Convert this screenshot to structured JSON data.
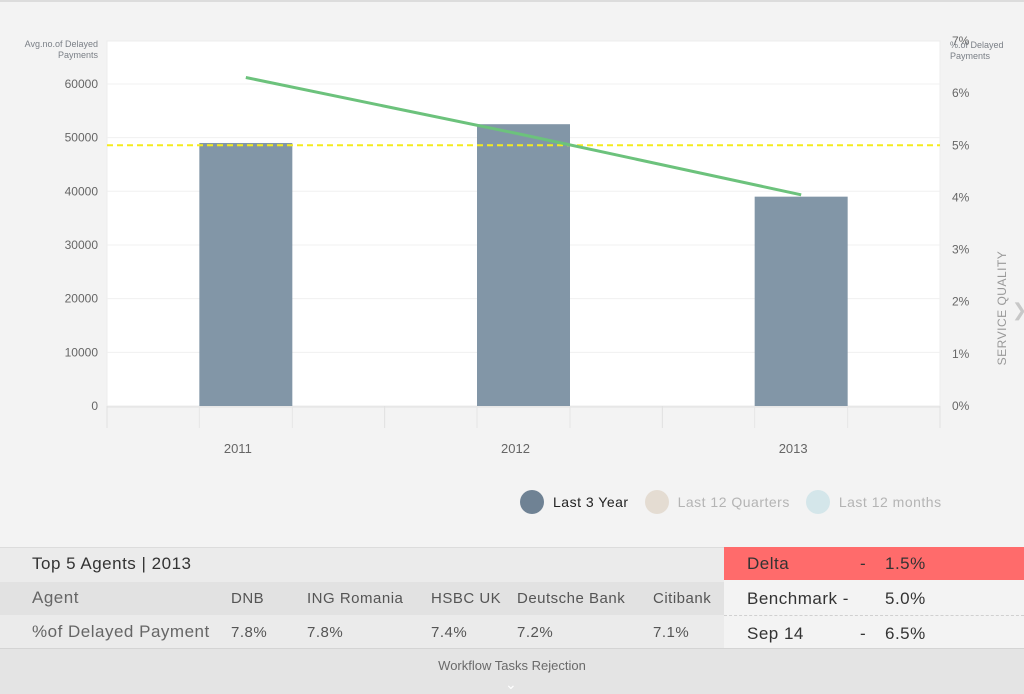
{
  "chart_data": {
    "type": "bar",
    "categories": [
      "2011",
      "2012",
      "2013"
    ],
    "series": [
      {
        "values": [
          49000,
          52500,
          39000
        ]
      }
    ],
    "line_series": [
      {
        "values": [
          6.3,
          5.2,
          4.05
        ]
      }
    ],
    "benchmark": 5.0,
    "y_left": {
      "label": "Avg.no.of Delayed Payments",
      "ticks": [
        0,
        10000,
        20000,
        30000,
        40000,
        50000,
        60000
      ],
      "ylim": [
        0,
        68000
      ]
    },
    "y_right": {
      "label": "%.of Delayed Payments",
      "ticks": [
        "0%",
        "1%",
        "2%",
        "3%",
        "4%",
        "5%",
        "6%",
        "7%"
      ],
      "ylim": [
        0,
        7.0
      ]
    },
    "right_side_label": "SERVICE QUALITY",
    "colors": {
      "bar": "#8296a7",
      "line": "#6cc27c",
      "benchmark": "#f5eb1e"
    }
  },
  "legend": [
    {
      "label": "Last 3 Year",
      "color": "#6f8294",
      "active": true
    },
    {
      "label": "Last 12 Quarters",
      "color": "#e4dcd2",
      "active": false
    },
    {
      "label": "Last 12 months",
      "color": "#d4e6ea",
      "active": false
    }
  ],
  "agents": {
    "title": "Top 5 Agents | 2013",
    "row_label_agent": "Agent",
    "row_label_pct": "%of Delayed Payment",
    "names": [
      "DNB",
      "ING Romania",
      "HSBC UK",
      "Deutsche Bank",
      "Citibank"
    ],
    "values": [
      "7.8%",
      "7.8%",
      "7.4%",
      "7.2%",
      "7.1%"
    ]
  },
  "metrics": {
    "delta": {
      "label": "Delta",
      "sep": "-",
      "value": "1.5%"
    },
    "benchmark": {
      "label": "Benchmark -",
      "value": "5.0%"
    },
    "sep14": {
      "label": "Sep 14",
      "sep": "-",
      "value": "6.5%"
    }
  },
  "footer": {
    "label": "Workflow Tasks Rejection"
  },
  "icons": {
    "side": "chevron-right-icon",
    "footer": "chevron-down-icon"
  }
}
